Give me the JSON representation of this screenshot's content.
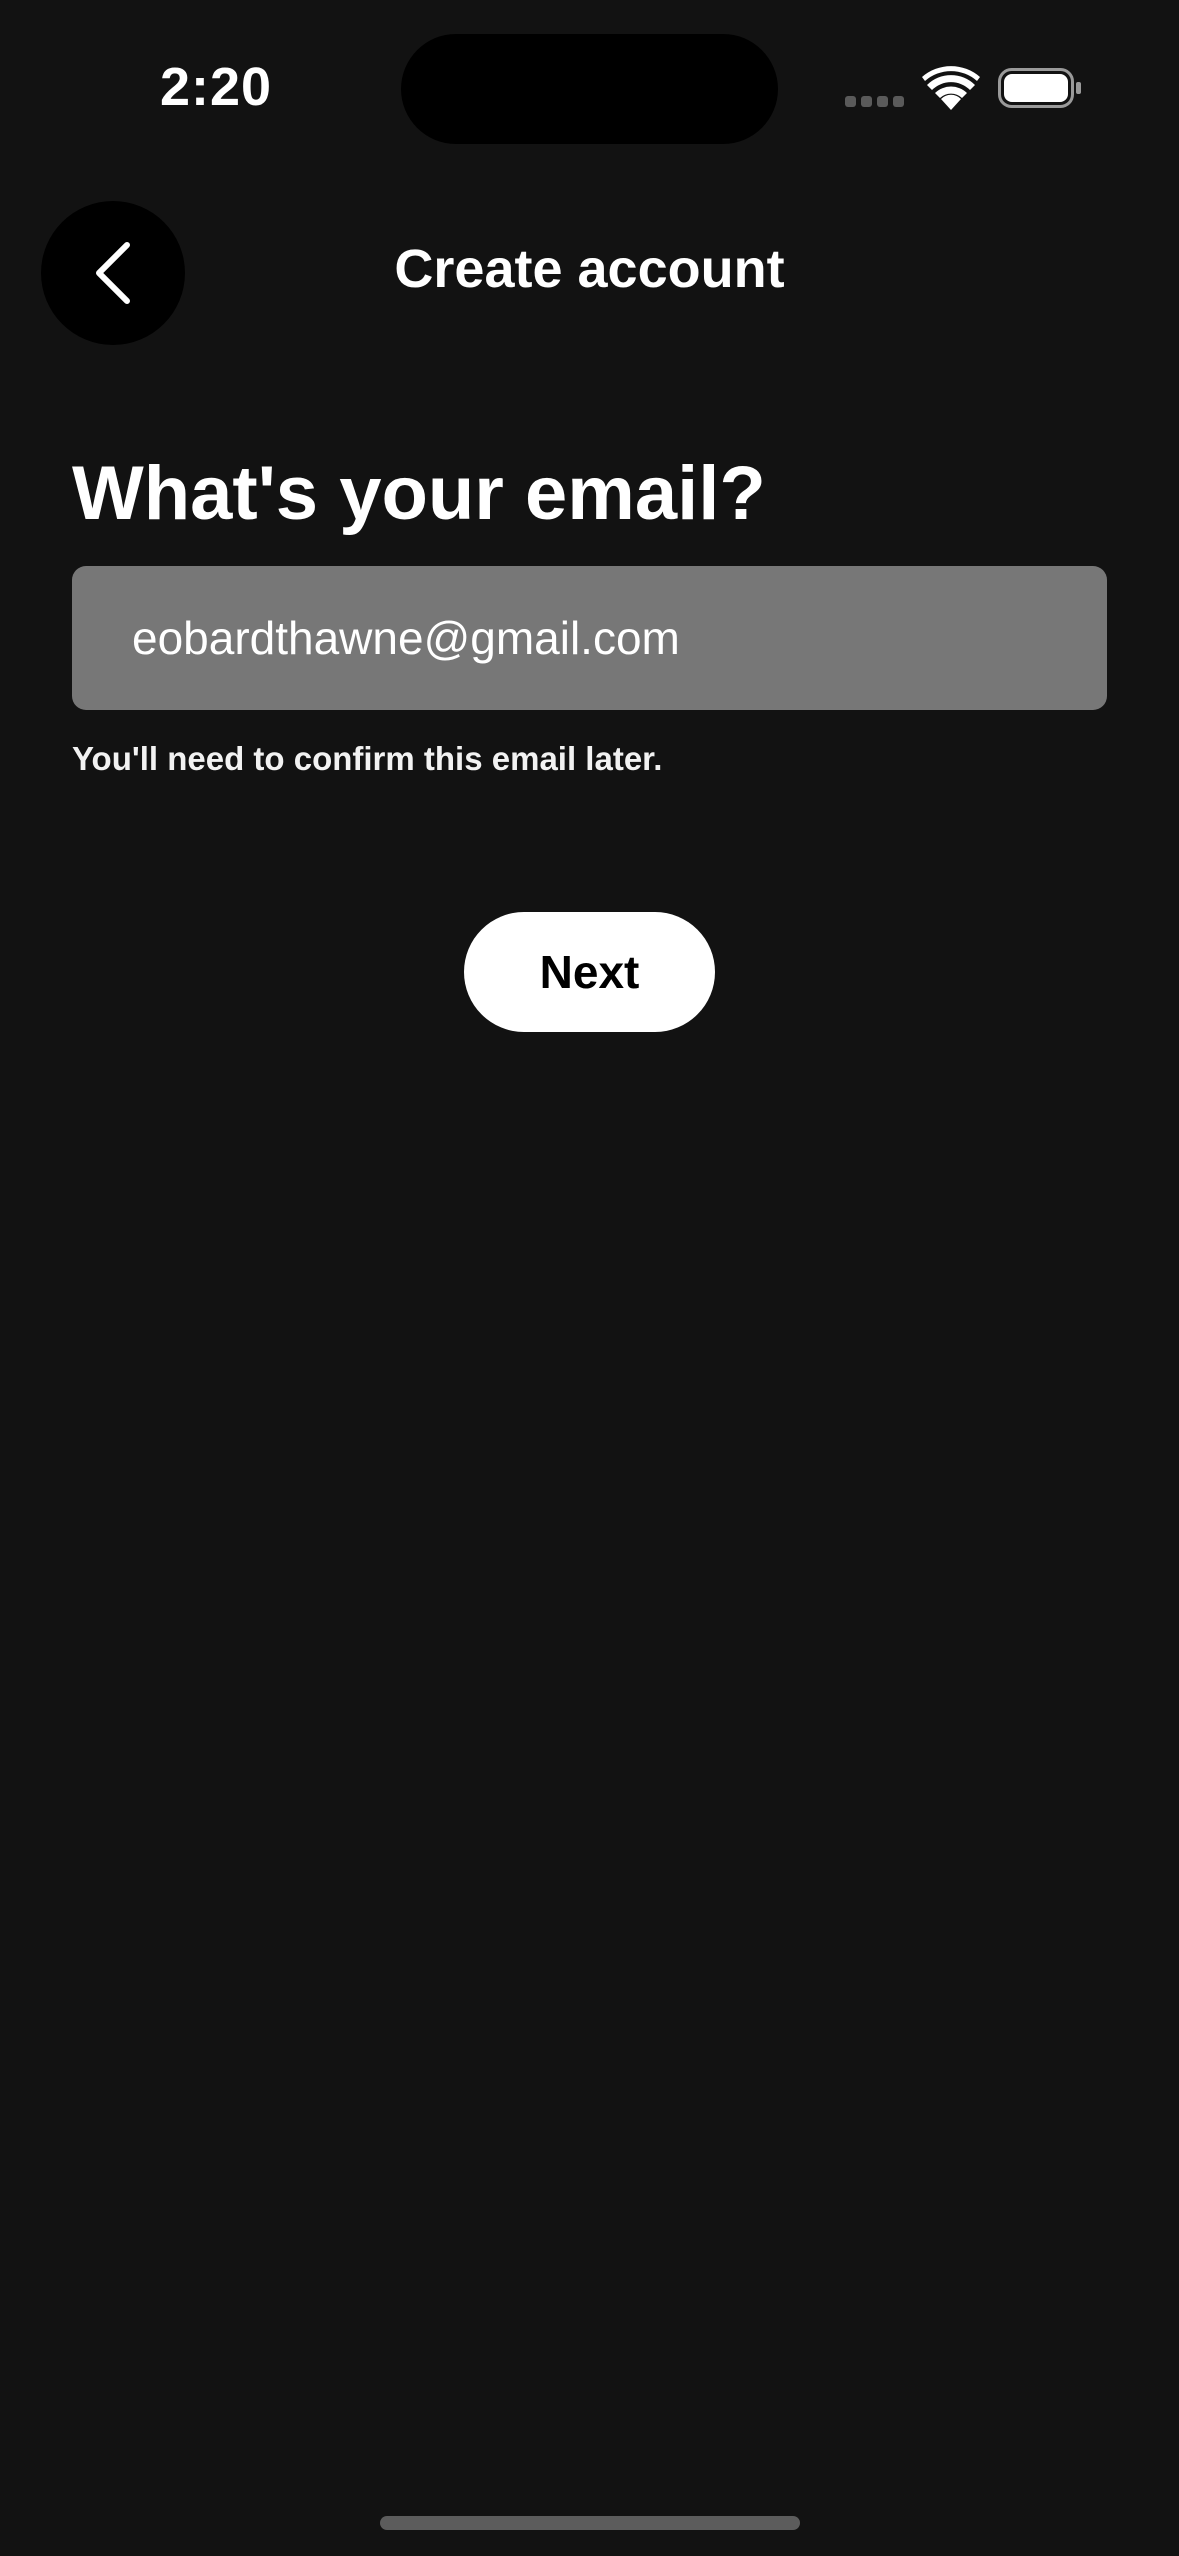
{
  "status_bar": {
    "time": "2:20"
  },
  "header": {
    "back_icon": "chevron-left-icon",
    "title": "Create account"
  },
  "form": {
    "heading": "What's your email?",
    "email_value": "eobardthawne@gmail.com",
    "helper": "You'll need to confirm this email later.",
    "next_label": "Next"
  },
  "colors": {
    "background": "#121212",
    "field": "#777777",
    "button": "#ffffff"
  }
}
